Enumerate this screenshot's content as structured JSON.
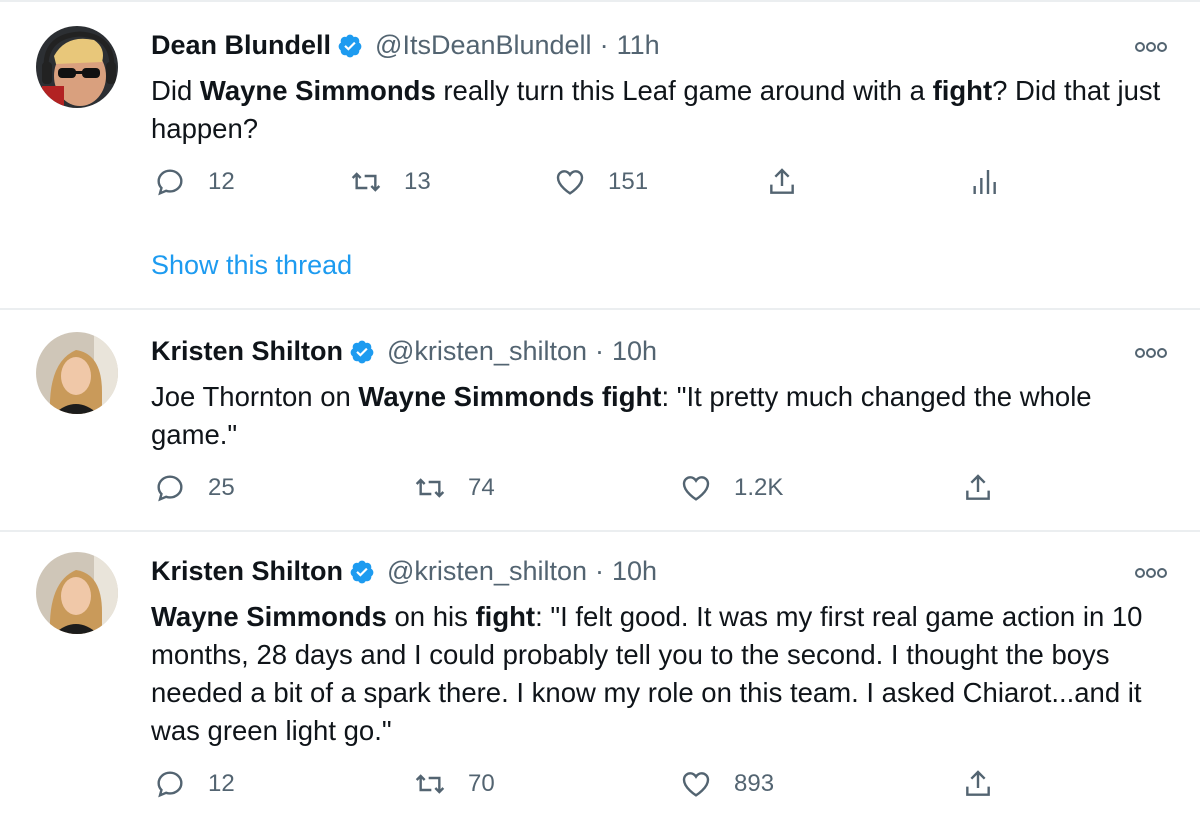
{
  "tweets": [
    {
      "name": "Dean Blundell",
      "handle": "@ItsDeanBlundell",
      "separator": "·",
      "time": "11h",
      "text_parts": [
        {
          "t": "Did ",
          "b": false
        },
        {
          "t": "Wayne Simmonds",
          "b": true
        },
        {
          "t": " really turn this Leaf game around with a ",
          "b": false
        },
        {
          "t": "fight",
          "b": true
        },
        {
          "t": "?  Did that just happen?",
          "b": false
        }
      ],
      "replies": "12",
      "retweets": "13",
      "likes": "151",
      "show_thread": "Show this thread",
      "has_analytics": true
    },
    {
      "name": "Kristen Shilton",
      "handle": "@kristen_shilton",
      "separator": "·",
      "time": "10h",
      "text_parts": [
        {
          "t": "Joe Thornton on ",
          "b": false
        },
        {
          "t": "Wayne Simmonds fight",
          "b": true
        },
        {
          "t": ": \"It pretty much changed the whole game.\"",
          "b": false
        }
      ],
      "replies": "25",
      "retweets": "74",
      "likes": "1.2K",
      "has_analytics": false
    },
    {
      "name": "Kristen Shilton",
      "handle": "@kristen_shilton",
      "separator": "·",
      "time": "10h",
      "text_parts": [
        {
          "t": "Wayne Simmonds",
          "b": true
        },
        {
          "t": " on his ",
          "b": false
        },
        {
          "t": "fight",
          "b": true
        },
        {
          "t": ": \"I felt good. It was my first real game action in 10 months, 28 days and I could probably tell you to the second. I thought the boys needed a bit of a spark there. I know my role on this team. I asked Chiarot...and it was green light go.\"",
          "b": false
        }
      ],
      "replies": "12",
      "retweets": "70",
      "likes": "893",
      "has_analytics": false
    }
  ],
  "colors": {
    "text": "#0f1419",
    "muted": "#536471",
    "link": "#1d9bf0",
    "verified": "#1d9bf0",
    "divider": "#ebeef0"
  },
  "icons": [
    "verified-badge-icon",
    "more-icon",
    "reply-icon",
    "retweet-icon",
    "like-icon",
    "share-icon",
    "analytics-icon"
  ]
}
